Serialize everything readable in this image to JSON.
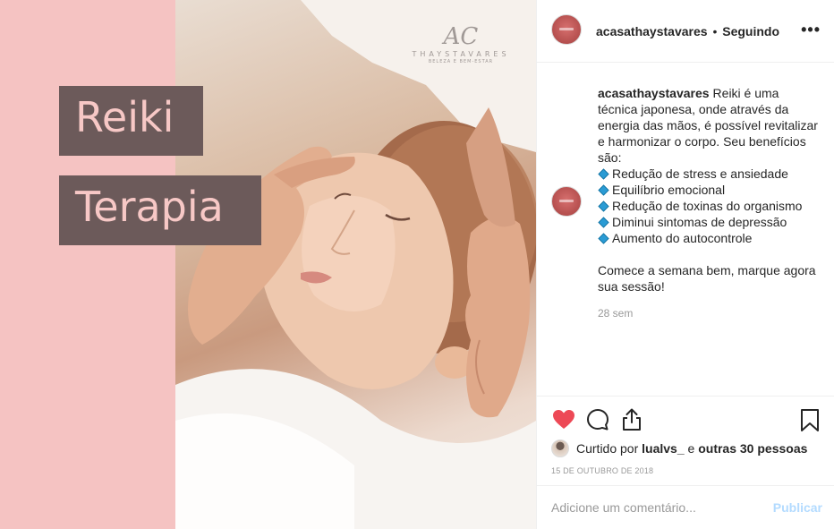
{
  "media": {
    "title_line1": "Reiki",
    "title_line2": "Terapia",
    "watermark": {
      "script": "AC",
      "name": "THAYSTAVARES",
      "sub": "BELEZA E BEM-ESTAR"
    }
  },
  "header": {
    "username": "acasathaystavares",
    "separator": "•",
    "follow_status": "Seguindo",
    "more_icon": "more-horizontal-icon"
  },
  "caption": {
    "username": "acasathaystavares",
    "intro": "Reiki é uma técnica japonesa, onde através da energia das mãos, é possível revitalizar e harmonizar o corpo. Seu benefícios são:",
    "bullets": [
      "Redução de stress e ansiedade",
      "Equilíbrio emocional",
      "Redução de toxinas do organismo",
      "Diminui sintomas de depressão",
      "Aumento do autocontrole"
    ],
    "outro": "Comece a semana bem, marque agora sua sessão!",
    "time_ago": "28 sem"
  },
  "actions": {
    "liked": true,
    "like_color": "#ed4956",
    "liked_by_prefix": "Curtido por",
    "liked_by_user": "lualvs_",
    "liked_by_connector": "e",
    "liked_by_others": "outras 30 pessoas",
    "date": "15 DE OUTUBRO DE 2018"
  },
  "comment": {
    "placeholder": "Adicione um comentário...",
    "publish_label": "Publicar",
    "publish_color": "#b3dbff"
  }
}
